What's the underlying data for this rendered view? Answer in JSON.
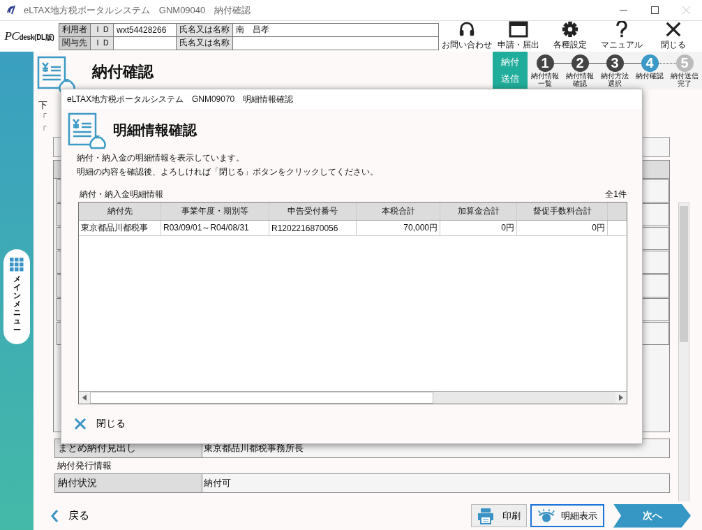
{
  "window": {
    "title": "eLTAX地方税ポータルシステム　GNM09040　納付確認"
  },
  "header": {
    "product": "PCdesk",
    "edition": "(DL版)"
  },
  "user_table": [
    {
      "label": "利用者",
      "id_label": "ＩＤ",
      "id": "wxt54428266",
      "name_label": "氏名又は名称",
      "name": "南　昌孝"
    },
    {
      "label": "関与先",
      "id_label": "ＩＤ",
      "name_label": "氏名又は名称"
    }
  ],
  "toolbar": [
    {
      "label": "お問い合わせ",
      "kind": "headset"
    },
    {
      "label": "申請・届出",
      "kind": "window"
    },
    {
      "label": "各種設定",
      "kind": "gear"
    },
    {
      "label": "マニュアル",
      "kind": "help"
    },
    {
      "label": "閉じる",
      "kind": "close"
    }
  ],
  "sidebar": {
    "menu_label": "メインメニュー"
  },
  "page": {
    "title": "納付確認"
  },
  "steps": {
    "group_label": [
      "納付",
      "送信"
    ],
    "items": [
      {
        "number": "1",
        "label": "納付情報一覧",
        "completed": true,
        "selected": false
      },
      {
        "number": "2",
        "label": "納付情報確認",
        "completed": true,
        "selected": false
      },
      {
        "number": "3",
        "label": "納付方法選択",
        "completed": true,
        "selected": false
      },
      {
        "number": "4",
        "label": "納付確認",
        "completed": false,
        "selected": true
      },
      {
        "number": "5",
        "label": "納付送信完了",
        "completed": false,
        "selected": false
      }
    ]
  },
  "background": {
    "intro_lines": [
      "下",
      "「",
      "「"
    ],
    "summary_rows": [
      {
        "label": "まとめ納付見出し",
        "value": "東京都品川都税事務所長"
      }
    ],
    "issue_section": "納付発行情報",
    "issue_rows": [
      {
        "label": "納付状況",
        "value": "納付可"
      }
    ]
  },
  "dialog": {
    "title": "eLTAX地方税ポータルシステム　GNM09070　明細情報確認",
    "heading": "明細情報確認",
    "description": [
      "納付・納入金の明細情報を表示しています。",
      "明細の内容を確認後、よろしければ「閉じる」ボタンをクリックしてください。"
    ],
    "table_title": "納付・納入金明細情報",
    "count": "全1件",
    "columns": [
      "納付先",
      "事業年度・期別等",
      "申告受付番号",
      "本税合計",
      "加算金合計",
      "督促手数料合計"
    ],
    "rows": [
      [
        "東京都品川都税事",
        "R03/09/01～R04/08/31",
        "R1202216870056",
        "70,000円",
        "0円",
        "0円"
      ]
    ],
    "close_label": "閉じる"
  },
  "footer": {
    "back": "戻る",
    "print": "印刷",
    "details": "明細表示",
    "details_focused": true,
    "next": "次へ"
  }
}
